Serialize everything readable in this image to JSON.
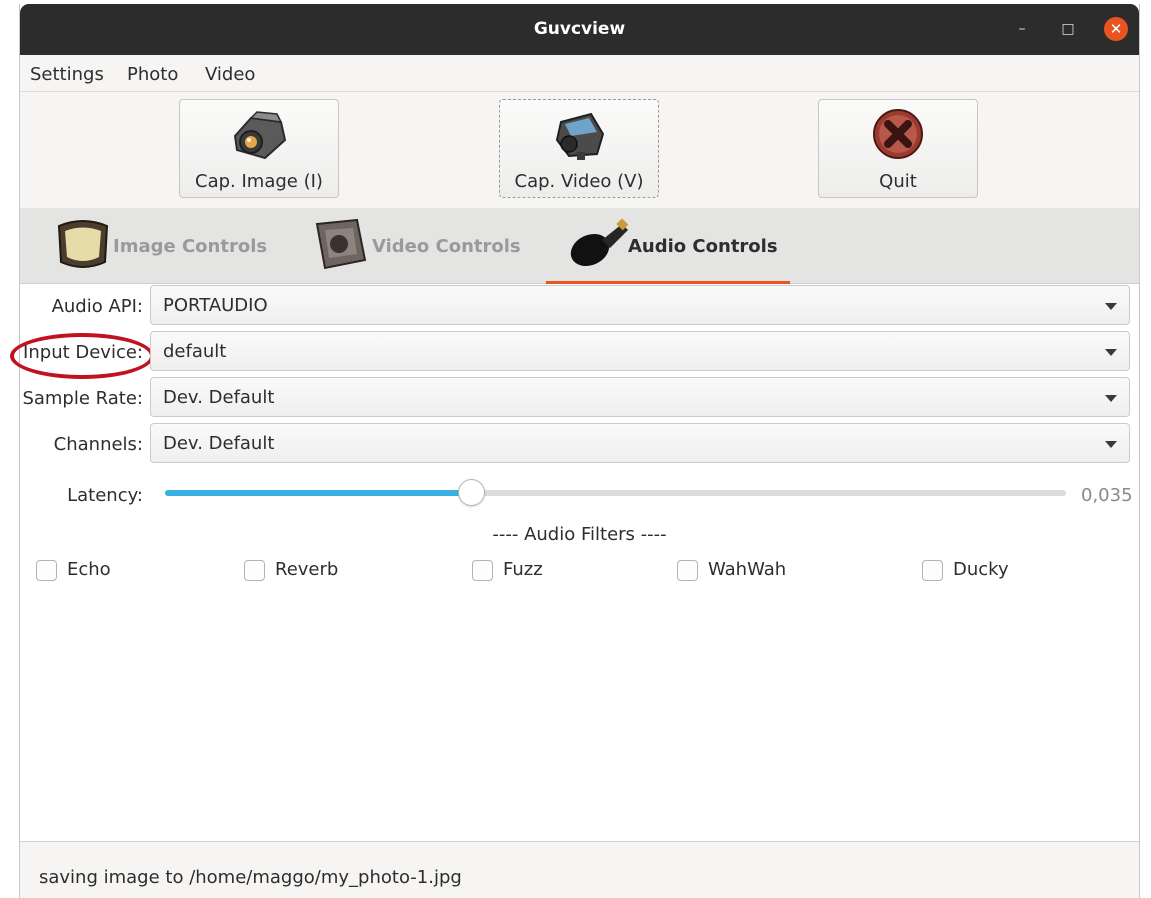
{
  "window": {
    "title": "Guvcview"
  },
  "menubar": {
    "items": [
      "Settings",
      "Photo",
      "Video"
    ]
  },
  "toolbar": {
    "cap_image_label": "Cap. Image (I)",
    "cap_video_label": "Cap. Video (V)",
    "quit_label": "Quit"
  },
  "tabs": [
    {
      "label": "Image Controls",
      "active": false
    },
    {
      "label": "Video Controls",
      "active": false
    },
    {
      "label": "Audio Controls",
      "active": true
    }
  ],
  "audio": {
    "api_label": "Audio API:",
    "api_value": "PORTAUDIO",
    "input_device_label": "Input Device:",
    "input_device_value": "default",
    "sample_rate_label": "Sample Rate:",
    "sample_rate_value": "Dev. Default",
    "channels_label": "Channels:",
    "channels_value": "Dev. Default",
    "latency_label": "Latency:",
    "latency_value": "0,035",
    "latency_fraction": 0.34
  },
  "filters": {
    "heading": "---- Audio Filters ----",
    "items": [
      {
        "label": "Echo",
        "checked": false
      },
      {
        "label": "Reverb",
        "checked": false
      },
      {
        "label": "Fuzz",
        "checked": false
      },
      {
        "label": "WahWah",
        "checked": false
      },
      {
        "label": "Ducky",
        "checked": false
      }
    ]
  },
  "status": {
    "text": "saving image to /home/maggo/my_photo-1.jpg"
  },
  "colors": {
    "accent": "#e95420",
    "slider": "#3ab0e2",
    "annotation": "#c1121f",
    "titlebar": "#2c2c2c"
  }
}
